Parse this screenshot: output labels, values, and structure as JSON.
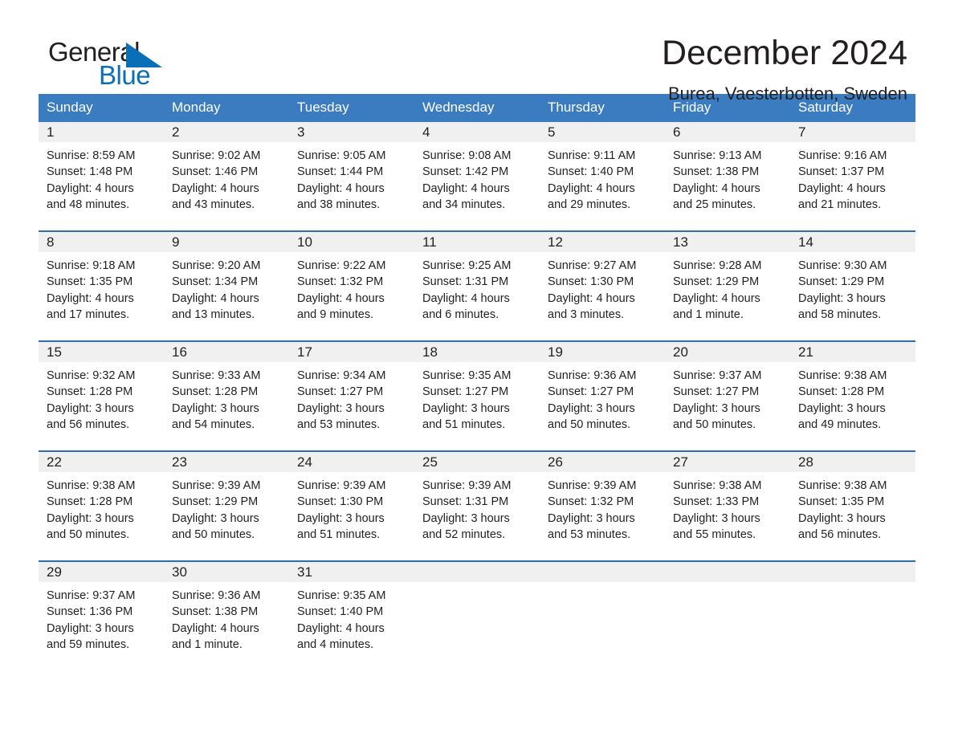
{
  "brand": {
    "name_part1": "General",
    "name_part2": "Blue",
    "accent_color": "#0b6fb8",
    "logo_icon": "triangle-flag-icon"
  },
  "header": {
    "month_title": "December 2024",
    "location": "Burea, Vaesterbotten, Sweden"
  },
  "calendar": {
    "header_bg": "#3a7cbf",
    "row_divider_color": "#2f6fb0",
    "daynum_band_bg": "#f0f0f0",
    "weekday_headers": [
      "Sunday",
      "Monday",
      "Tuesday",
      "Wednesday",
      "Thursday",
      "Friday",
      "Saturday"
    ],
    "weeks": [
      [
        {
          "day": "1",
          "sunrise": "Sunrise: 8:59 AM",
          "sunset": "Sunset: 1:48 PM",
          "daylight_line1": "Daylight: 4 hours",
          "daylight_line2": "and 48 minutes."
        },
        {
          "day": "2",
          "sunrise": "Sunrise: 9:02 AM",
          "sunset": "Sunset: 1:46 PM",
          "daylight_line1": "Daylight: 4 hours",
          "daylight_line2": "and 43 minutes."
        },
        {
          "day": "3",
          "sunrise": "Sunrise: 9:05 AM",
          "sunset": "Sunset: 1:44 PM",
          "daylight_line1": "Daylight: 4 hours",
          "daylight_line2": "and 38 minutes."
        },
        {
          "day": "4",
          "sunrise": "Sunrise: 9:08 AM",
          "sunset": "Sunset: 1:42 PM",
          "daylight_line1": "Daylight: 4 hours",
          "daylight_line2": "and 34 minutes."
        },
        {
          "day": "5",
          "sunrise": "Sunrise: 9:11 AM",
          "sunset": "Sunset: 1:40 PM",
          "daylight_line1": "Daylight: 4 hours",
          "daylight_line2": "and 29 minutes."
        },
        {
          "day": "6",
          "sunrise": "Sunrise: 9:13 AM",
          "sunset": "Sunset: 1:38 PM",
          "daylight_line1": "Daylight: 4 hours",
          "daylight_line2": "and 25 minutes."
        },
        {
          "day": "7",
          "sunrise": "Sunrise: 9:16 AM",
          "sunset": "Sunset: 1:37 PM",
          "daylight_line1": "Daylight: 4 hours",
          "daylight_line2": "and 21 minutes."
        }
      ],
      [
        {
          "day": "8",
          "sunrise": "Sunrise: 9:18 AM",
          "sunset": "Sunset: 1:35 PM",
          "daylight_line1": "Daylight: 4 hours",
          "daylight_line2": "and 17 minutes."
        },
        {
          "day": "9",
          "sunrise": "Sunrise: 9:20 AM",
          "sunset": "Sunset: 1:34 PM",
          "daylight_line1": "Daylight: 4 hours",
          "daylight_line2": "and 13 minutes."
        },
        {
          "day": "10",
          "sunrise": "Sunrise: 9:22 AM",
          "sunset": "Sunset: 1:32 PM",
          "daylight_line1": "Daylight: 4 hours",
          "daylight_line2": "and 9 minutes."
        },
        {
          "day": "11",
          "sunrise": "Sunrise: 9:25 AM",
          "sunset": "Sunset: 1:31 PM",
          "daylight_line1": "Daylight: 4 hours",
          "daylight_line2": "and 6 minutes."
        },
        {
          "day": "12",
          "sunrise": "Sunrise: 9:27 AM",
          "sunset": "Sunset: 1:30 PM",
          "daylight_line1": "Daylight: 4 hours",
          "daylight_line2": "and 3 minutes."
        },
        {
          "day": "13",
          "sunrise": "Sunrise: 9:28 AM",
          "sunset": "Sunset: 1:29 PM",
          "daylight_line1": "Daylight: 4 hours",
          "daylight_line2": "and 1 minute."
        },
        {
          "day": "14",
          "sunrise": "Sunrise: 9:30 AM",
          "sunset": "Sunset: 1:29 PM",
          "daylight_line1": "Daylight: 3 hours",
          "daylight_line2": "and 58 minutes."
        }
      ],
      [
        {
          "day": "15",
          "sunrise": "Sunrise: 9:32 AM",
          "sunset": "Sunset: 1:28 PM",
          "daylight_line1": "Daylight: 3 hours",
          "daylight_line2": "and 56 minutes."
        },
        {
          "day": "16",
          "sunrise": "Sunrise: 9:33 AM",
          "sunset": "Sunset: 1:28 PM",
          "daylight_line1": "Daylight: 3 hours",
          "daylight_line2": "and 54 minutes."
        },
        {
          "day": "17",
          "sunrise": "Sunrise: 9:34 AM",
          "sunset": "Sunset: 1:27 PM",
          "daylight_line1": "Daylight: 3 hours",
          "daylight_line2": "and 53 minutes."
        },
        {
          "day": "18",
          "sunrise": "Sunrise: 9:35 AM",
          "sunset": "Sunset: 1:27 PM",
          "daylight_line1": "Daylight: 3 hours",
          "daylight_line2": "and 51 minutes."
        },
        {
          "day": "19",
          "sunrise": "Sunrise: 9:36 AM",
          "sunset": "Sunset: 1:27 PM",
          "daylight_line1": "Daylight: 3 hours",
          "daylight_line2": "and 50 minutes."
        },
        {
          "day": "20",
          "sunrise": "Sunrise: 9:37 AM",
          "sunset": "Sunset: 1:27 PM",
          "daylight_line1": "Daylight: 3 hours",
          "daylight_line2": "and 50 minutes."
        },
        {
          "day": "21",
          "sunrise": "Sunrise: 9:38 AM",
          "sunset": "Sunset: 1:28 PM",
          "daylight_line1": "Daylight: 3 hours",
          "daylight_line2": "and 49 minutes."
        }
      ],
      [
        {
          "day": "22",
          "sunrise": "Sunrise: 9:38 AM",
          "sunset": "Sunset: 1:28 PM",
          "daylight_line1": "Daylight: 3 hours",
          "daylight_line2": "and 50 minutes."
        },
        {
          "day": "23",
          "sunrise": "Sunrise: 9:39 AM",
          "sunset": "Sunset: 1:29 PM",
          "daylight_line1": "Daylight: 3 hours",
          "daylight_line2": "and 50 minutes."
        },
        {
          "day": "24",
          "sunrise": "Sunrise: 9:39 AM",
          "sunset": "Sunset: 1:30 PM",
          "daylight_line1": "Daylight: 3 hours",
          "daylight_line2": "and 51 minutes."
        },
        {
          "day": "25",
          "sunrise": "Sunrise: 9:39 AM",
          "sunset": "Sunset: 1:31 PM",
          "daylight_line1": "Daylight: 3 hours",
          "daylight_line2": "and 52 minutes."
        },
        {
          "day": "26",
          "sunrise": "Sunrise: 9:39 AM",
          "sunset": "Sunset: 1:32 PM",
          "daylight_line1": "Daylight: 3 hours",
          "daylight_line2": "and 53 minutes."
        },
        {
          "day": "27",
          "sunrise": "Sunrise: 9:38 AM",
          "sunset": "Sunset: 1:33 PM",
          "daylight_line1": "Daylight: 3 hours",
          "daylight_line2": "and 55 minutes."
        },
        {
          "day": "28",
          "sunrise": "Sunrise: 9:38 AM",
          "sunset": "Sunset: 1:35 PM",
          "daylight_line1": "Daylight: 3 hours",
          "daylight_line2": "and 56 minutes."
        }
      ],
      [
        {
          "day": "29",
          "sunrise": "Sunrise: 9:37 AM",
          "sunset": "Sunset: 1:36 PM",
          "daylight_line1": "Daylight: 3 hours",
          "daylight_line2": "and 59 minutes."
        },
        {
          "day": "30",
          "sunrise": "Sunrise: 9:36 AM",
          "sunset": "Sunset: 1:38 PM",
          "daylight_line1": "Daylight: 4 hours",
          "daylight_line2": "and 1 minute."
        },
        {
          "day": "31",
          "sunrise": "Sunrise: 9:35 AM",
          "sunset": "Sunset: 1:40 PM",
          "daylight_line1": "Daylight: 4 hours",
          "daylight_line2": "and 4 minutes."
        },
        {
          "day": "",
          "sunrise": "",
          "sunset": "",
          "daylight_line1": "",
          "daylight_line2": ""
        },
        {
          "day": "",
          "sunrise": "",
          "sunset": "",
          "daylight_line1": "",
          "daylight_line2": ""
        },
        {
          "day": "",
          "sunrise": "",
          "sunset": "",
          "daylight_line1": "",
          "daylight_line2": ""
        },
        {
          "day": "",
          "sunrise": "",
          "sunset": "",
          "daylight_line1": "",
          "daylight_line2": ""
        }
      ]
    ]
  }
}
